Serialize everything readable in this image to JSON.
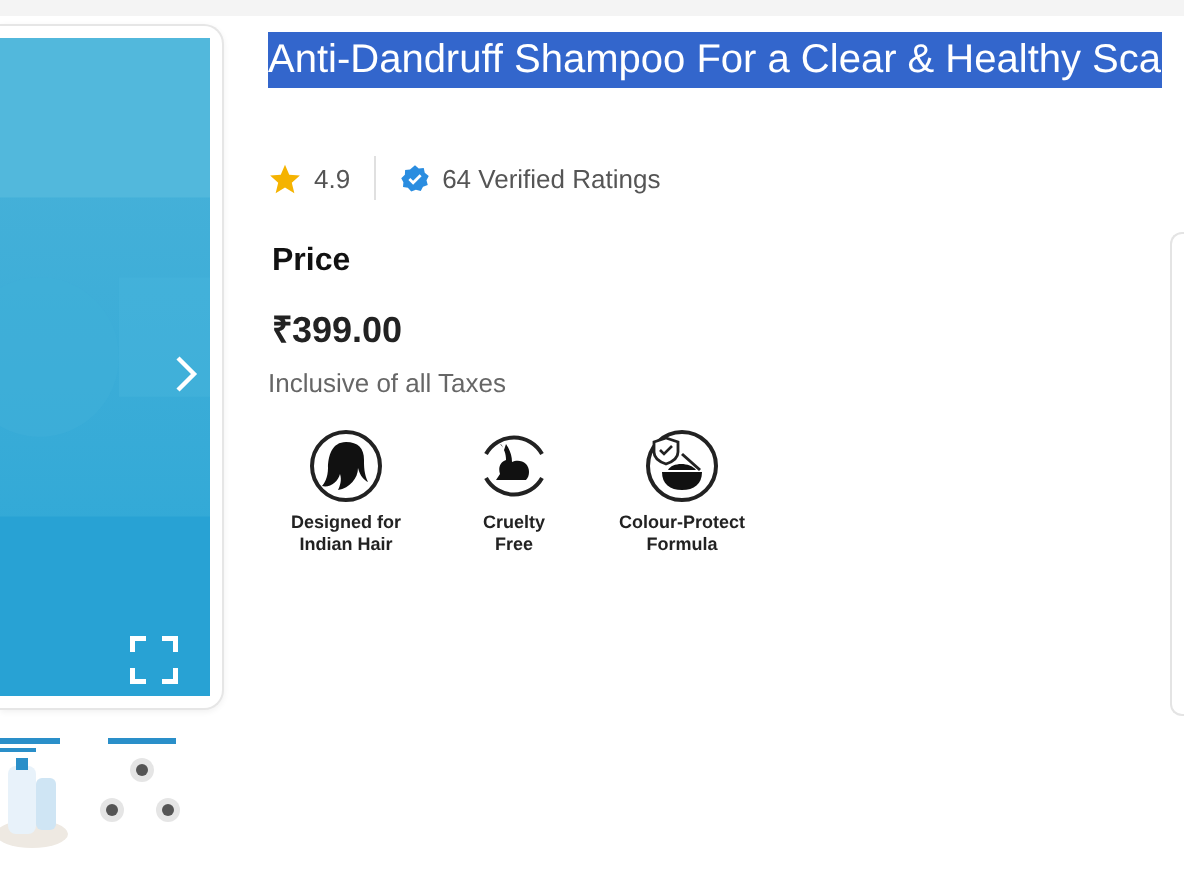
{
  "product": {
    "title": "Anti-Dandruff Shampoo For a Clear & Healthy Sca",
    "title_selected": true
  },
  "rating": {
    "score": "4.9",
    "verified": "64 Verified Ratings"
  },
  "price": {
    "heading": "Price",
    "amount": "₹399.00",
    "note": "Inclusive of all Taxes"
  },
  "features": [
    {
      "kind": "hair",
      "label": "Designed for\nIndian Hair"
    },
    {
      "kind": "rabbit",
      "label": "Cruelty\nFree"
    },
    {
      "kind": "bowl",
      "label": "Colour-Protect\nFormula"
    }
  ]
}
